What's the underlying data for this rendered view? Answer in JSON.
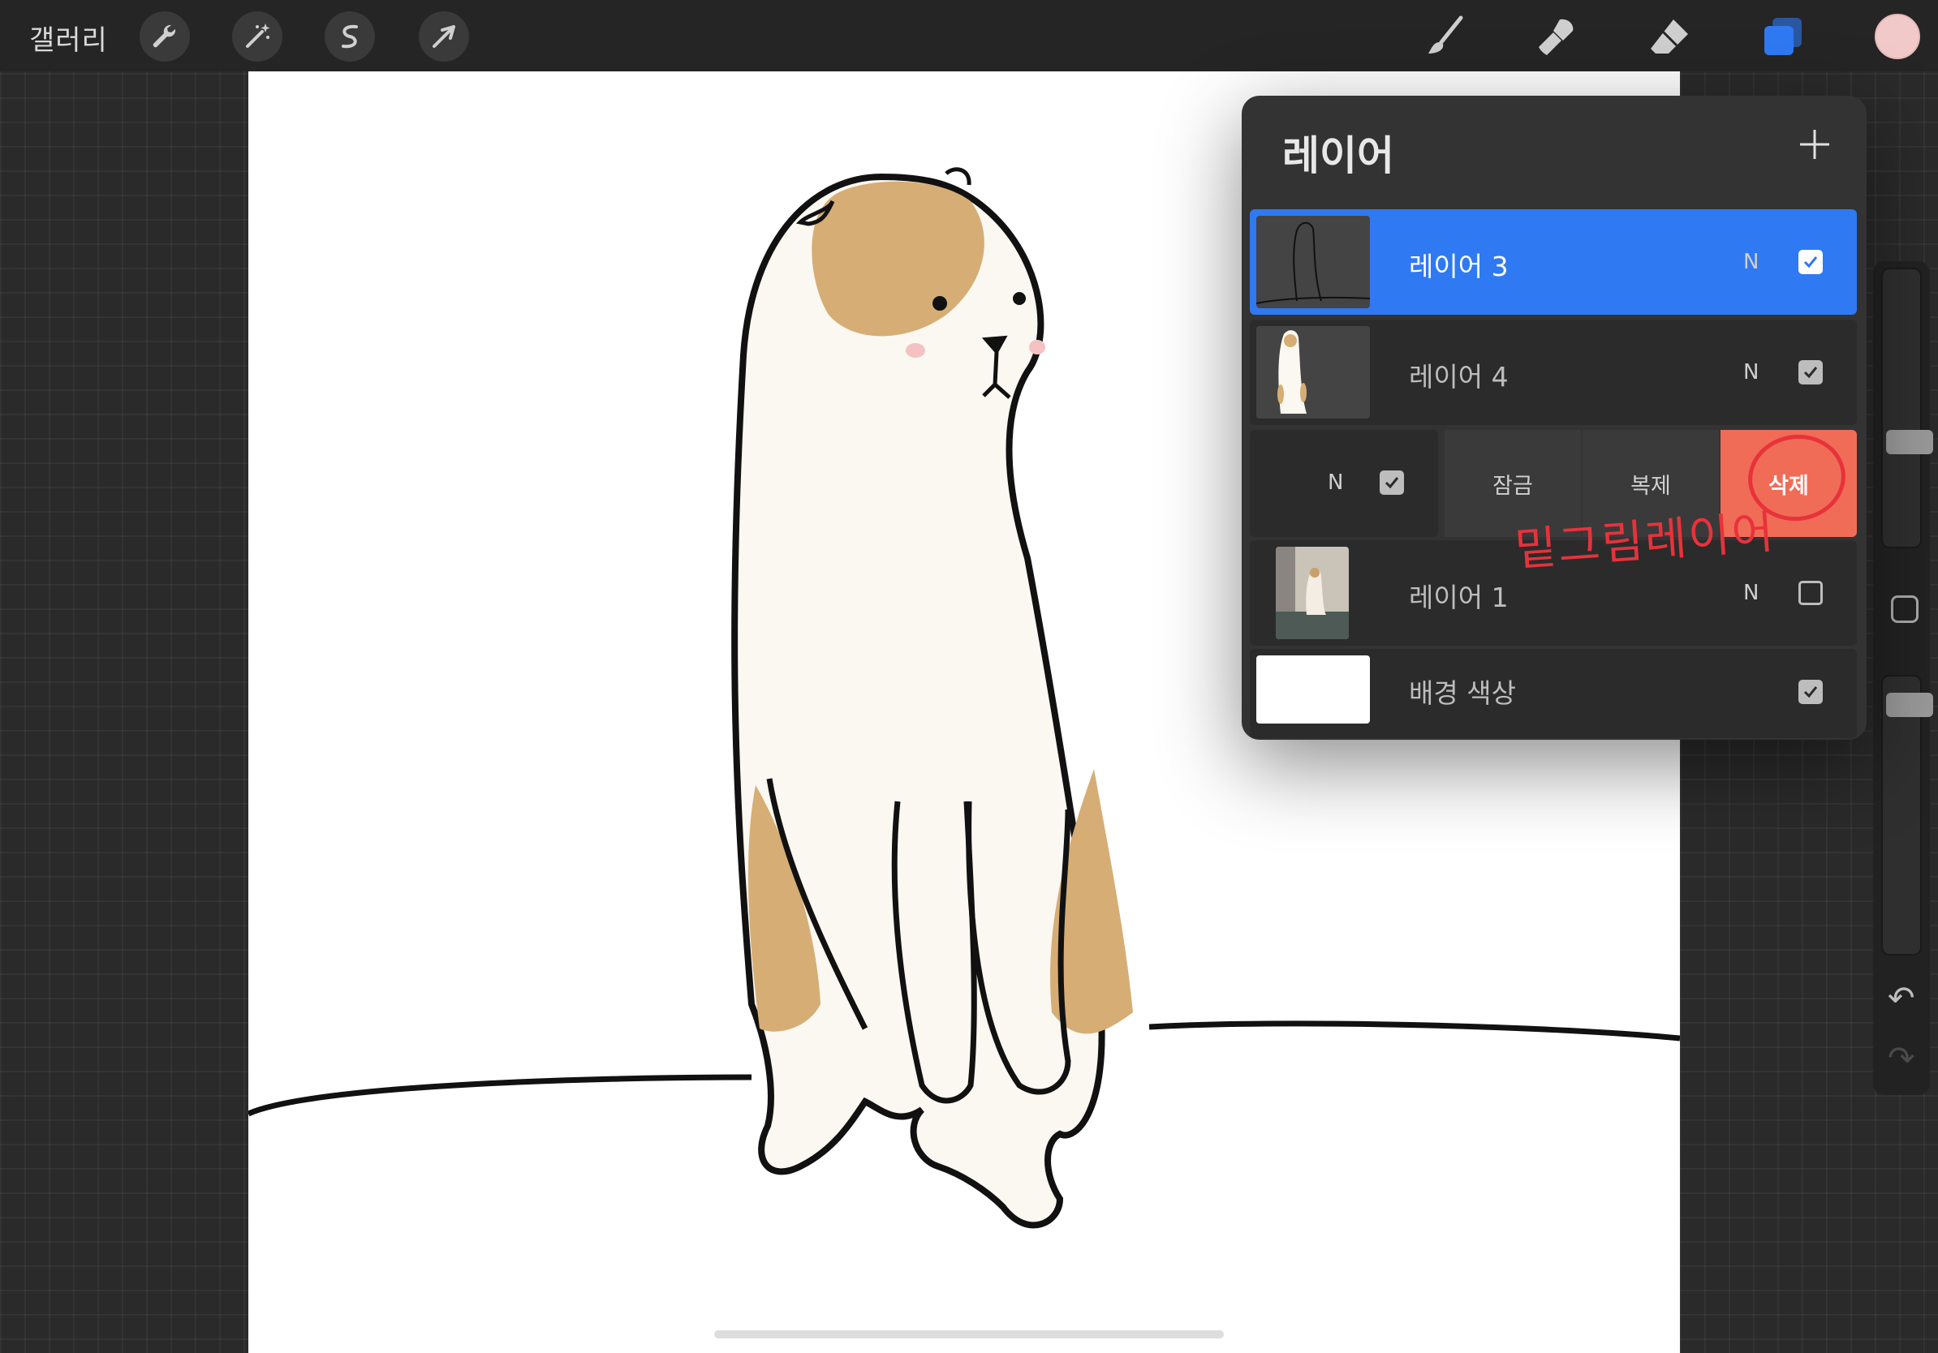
{
  "topbar": {
    "gallery_label": "갤러리",
    "left_tools": [
      "wrench-icon",
      "magic-wand-icon",
      "selection-icon",
      "transform-arrow-icon"
    ],
    "right_tools": [
      "brush-icon",
      "smudge-icon",
      "eraser-icon",
      "layers-icon"
    ],
    "active_color": "#f2c9c9",
    "accent_color": "#2f79f2"
  },
  "layers_panel": {
    "title": "레이어",
    "add_icon": "plus-icon",
    "layers": [
      {
        "name": "레이어 3",
        "blend": "N",
        "visible": true,
        "active": true
      },
      {
        "name": "레이어 4",
        "blend": "N",
        "visible": true,
        "active": false
      },
      {
        "name": "",
        "blend": "N",
        "visible": true,
        "active": false,
        "swiped": true
      },
      {
        "name": "레이어 1",
        "blend": "N",
        "visible": false,
        "active": false
      },
      {
        "name": "배경 색상",
        "visible": true,
        "active": false
      }
    ],
    "swipe_actions": {
      "lock": "잠금",
      "duplicate": "복제",
      "delete": "삭제",
      "delete_color": "#f06c57"
    },
    "annotation": "밑그림레이어"
  },
  "sidebar": {
    "undo_icon": "undo-icon",
    "redo_icon": "redo-icon"
  }
}
